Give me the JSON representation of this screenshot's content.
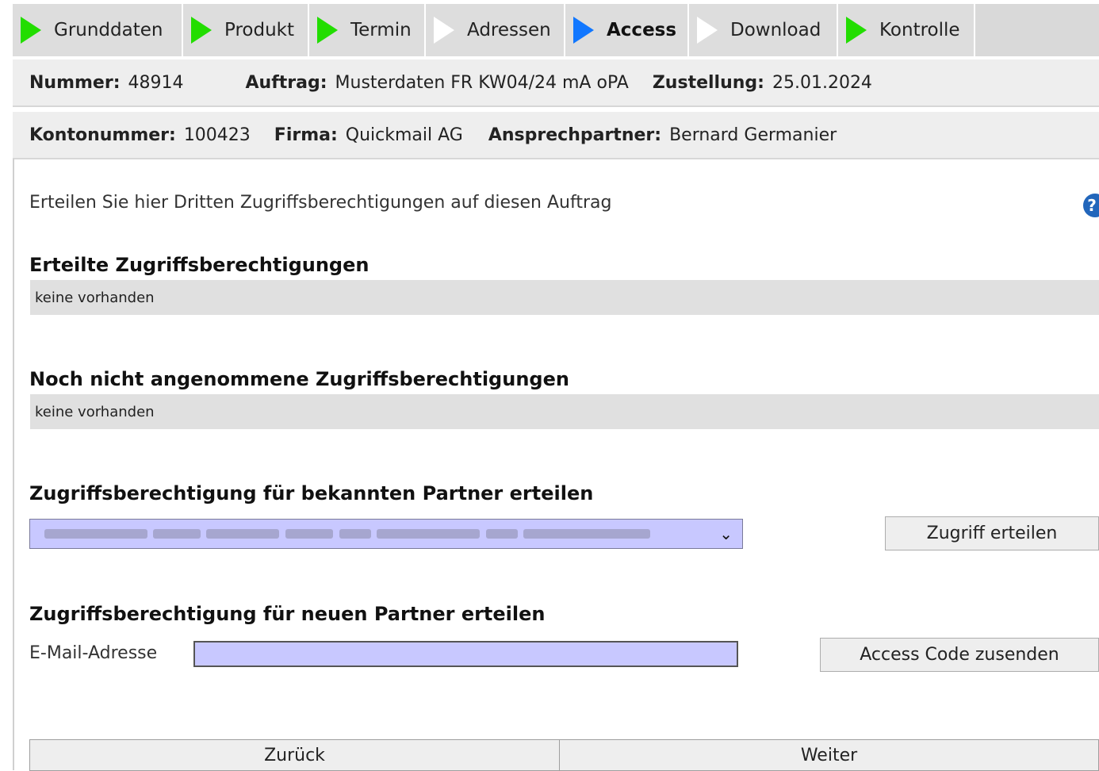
{
  "tabs": [
    {
      "label": "Grunddaten",
      "status": "done"
    },
    {
      "label": "Produkt",
      "status": "done"
    },
    {
      "label": "Termin",
      "status": "done"
    },
    {
      "label": "Adressen",
      "status": "open"
    },
    {
      "label": "Access",
      "status": "current"
    },
    {
      "label": "Download",
      "status": "open"
    },
    {
      "label": "Kontrolle",
      "status": "done"
    }
  ],
  "order_info": {
    "nummer_label": "Nummer:",
    "nummer_value": "48914",
    "auftrag_label": "Auftrag:",
    "auftrag_value": "Musterdaten FR KW04/24 mA oPA",
    "zustellung_label": "Zustellung:",
    "zustellung_value": "25.01.2024"
  },
  "account_info": {
    "konto_label": "Kontonummer:",
    "konto_value": "100423",
    "firma_label": "Firma:",
    "firma_value": "Quickmail AG",
    "ansprech_label": "Ansprechpartner:",
    "ansprech_value": "Bernard Germanier"
  },
  "intro_text": "Erteilen Sie hier Dritten Zugriffsberechtigungen auf diesen Auftrag",
  "help_icon_glyph": "?",
  "section_granted": {
    "title": "Erteilte Zugriffsberechtigungen",
    "empty_text": "keine vorhanden"
  },
  "section_pending": {
    "title": "Noch nicht angenommene Zugriffsberechtigungen",
    "empty_text": "keine vorhanden"
  },
  "section_known": {
    "title": "Zugriffsberechtigung für bekannten Partner erteilen",
    "button_label": "Zugriff erteilen"
  },
  "section_new": {
    "title": "Zugriffsberechtigung für neuen Partner erteilen",
    "email_label": "E-Mail-Adresse",
    "email_value": "",
    "button_label": "Access Code zusenden"
  },
  "nav": {
    "back_label": "Zurück",
    "next_label": "Weiter"
  },
  "colors": {
    "done": "#22dd00",
    "current": "#1177ff",
    "open": "#ffffff",
    "input_bg": "#c8c8ff"
  }
}
